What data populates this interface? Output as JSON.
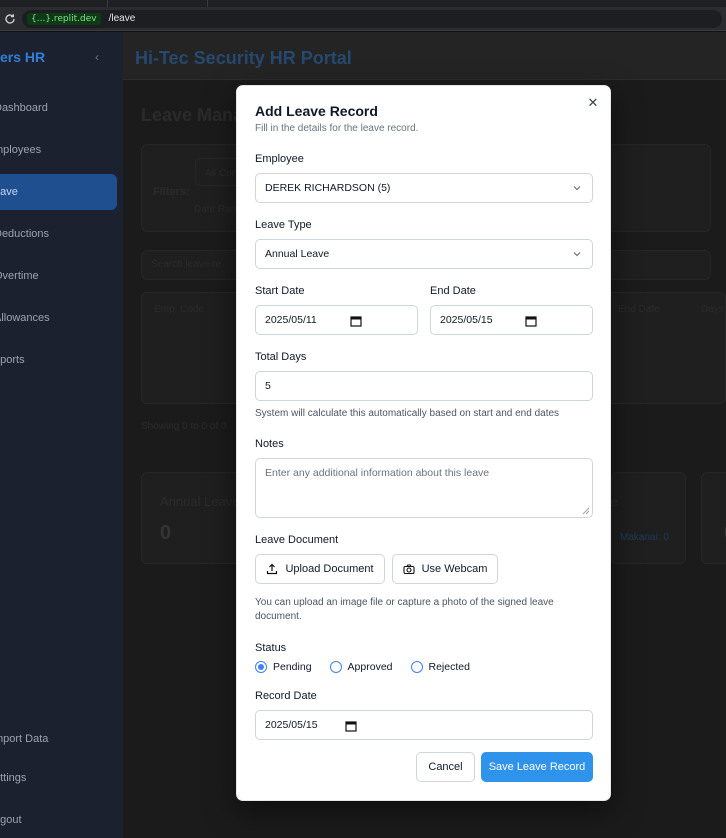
{
  "browser": {
    "url_host": "{...}.replit.dev",
    "url_path": "/leave"
  },
  "sidebar": {
    "brand": "ers HR",
    "items": [
      {
        "label": "Dashboard"
      },
      {
        "label": "mployees"
      },
      {
        "label": "eave"
      },
      {
        "label": "Deductions"
      },
      {
        "label": "Overtime"
      },
      {
        "label": "Allowances"
      },
      {
        "label": "eports"
      },
      {
        "label": "mport Data"
      },
      {
        "label": "ettings"
      },
      {
        "label": "ogout"
      }
    ]
  },
  "header": {
    "title": "Hi-Tec Security HR Portal"
  },
  "background_page": {
    "heading": "Leave Mana",
    "filters_label": "Filters:",
    "filter_select": "All Con",
    "date_range_label": "Date Ran",
    "search_placeholder": "Search leave re",
    "columns": [
      "Emp. Code",
      "End Date",
      "Days"
    ],
    "pagination": "Showing 0 to 0 of 0",
    "card_annual_title": "Annual Leave",
    "card_annual_value": "0",
    "card2_title": "e",
    "card2_sub": "Makanai: 0",
    "card3_value": "0"
  },
  "modal": {
    "title": "Add Leave Record",
    "description": "Fill in the details for the leave record.",
    "employee_label": "Employee",
    "employee_value": "DEREK RICHARDSON (5)",
    "leave_type_label": "Leave Type",
    "leave_type_value": "Annual Leave",
    "start_date_label": "Start Date",
    "start_date_value": "2025/05/11",
    "end_date_label": "End Date",
    "end_date_value": "2025/05/15",
    "total_days_label": "Total Days",
    "total_days_value": "5",
    "total_days_helper": "System will calculate this automatically based on start and end dates",
    "notes_label": "Notes",
    "notes_placeholder": "Enter any additional information about this leave",
    "document_label": "Leave Document",
    "upload_button": "Upload Document",
    "webcam_button": "Use Webcam",
    "document_helper_line1": "You can upload an image file or capture a photo of the signed leave",
    "document_helper_line2": "document.",
    "status_label": "Status",
    "status_options": [
      "Pending",
      "Approved",
      "Rejected"
    ],
    "status_selected": "Pending",
    "record_date_label": "Record Date",
    "record_date_value": "2025/05/15",
    "cancel_button": "Cancel",
    "save_button": "Save Leave Record"
  },
  "colors": {
    "primary": "#2f93ec",
    "radio": "#3b82f6"
  }
}
